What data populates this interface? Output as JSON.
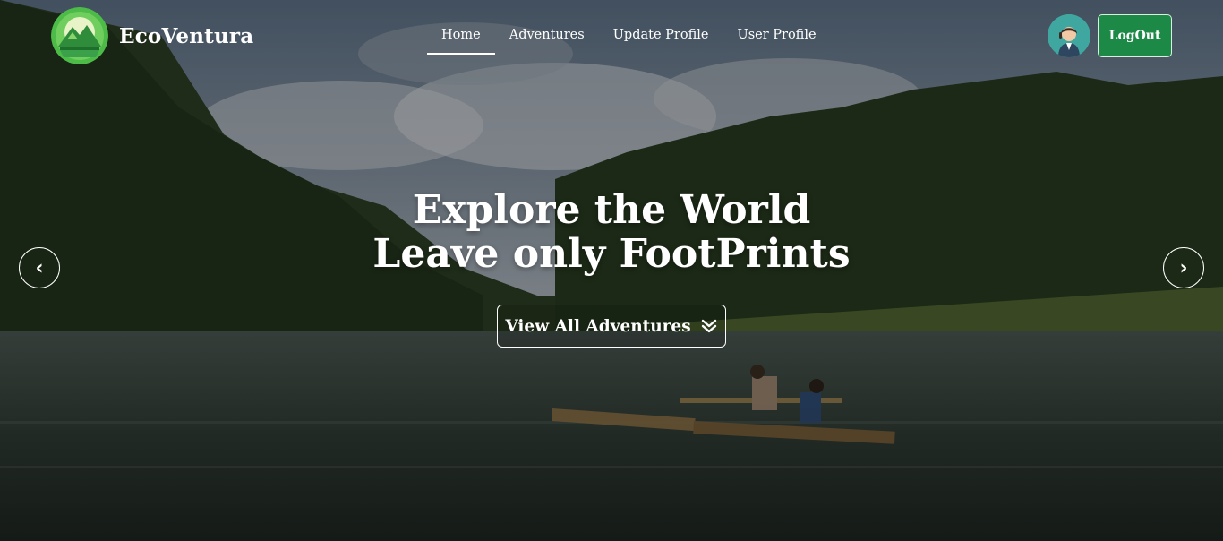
{
  "brand": {
    "name": "EcoVentura",
    "logo_icon": "mountain-logo-icon"
  },
  "nav": {
    "items": [
      {
        "label": "Home",
        "active": true
      },
      {
        "label": "Adventures",
        "active": false
      },
      {
        "label": "Update Profile",
        "active": false
      },
      {
        "label": "User Profile",
        "active": false
      }
    ]
  },
  "header": {
    "avatar_icon": "user-avatar-icon",
    "logout_label": "LogOut"
  },
  "hero": {
    "headline_line1": "Explore the World",
    "headline_line2": "Leave only FootPrints",
    "cta_label": "View All Adventures",
    "cta_icon": "double-chevron-down-icon",
    "prev_icon": "chevron-left-icon",
    "next_icon": "chevron-right-icon",
    "prev_glyph": "‹",
    "next_glyph": "›"
  },
  "colors": {
    "accent": "#1c8a46",
    "logo_green": "#4cbb47",
    "avatar_bg": "#3fa7a0"
  }
}
